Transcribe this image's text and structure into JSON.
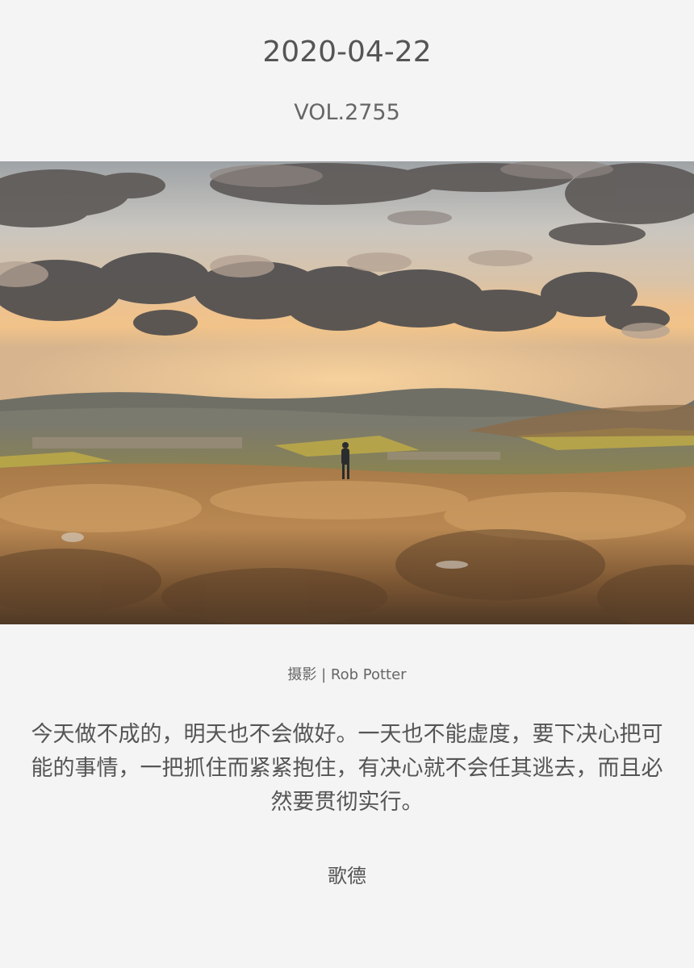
{
  "header": {
    "date": "2020-04-22",
    "volume": "VOL.2755"
  },
  "photo": {
    "credit": "摄影 | Rob Potter"
  },
  "quote": {
    "text": "今天做不成的，明天也不会做好。一天也不能虚度，要下决心把可能的事情，一把抓住而紧紧抱住，有决心就不会任其逃去，而且必然要贯彻实行。",
    "author": "歌德"
  },
  "colors": {
    "background": "#f4f4f4",
    "text": "#555555"
  }
}
